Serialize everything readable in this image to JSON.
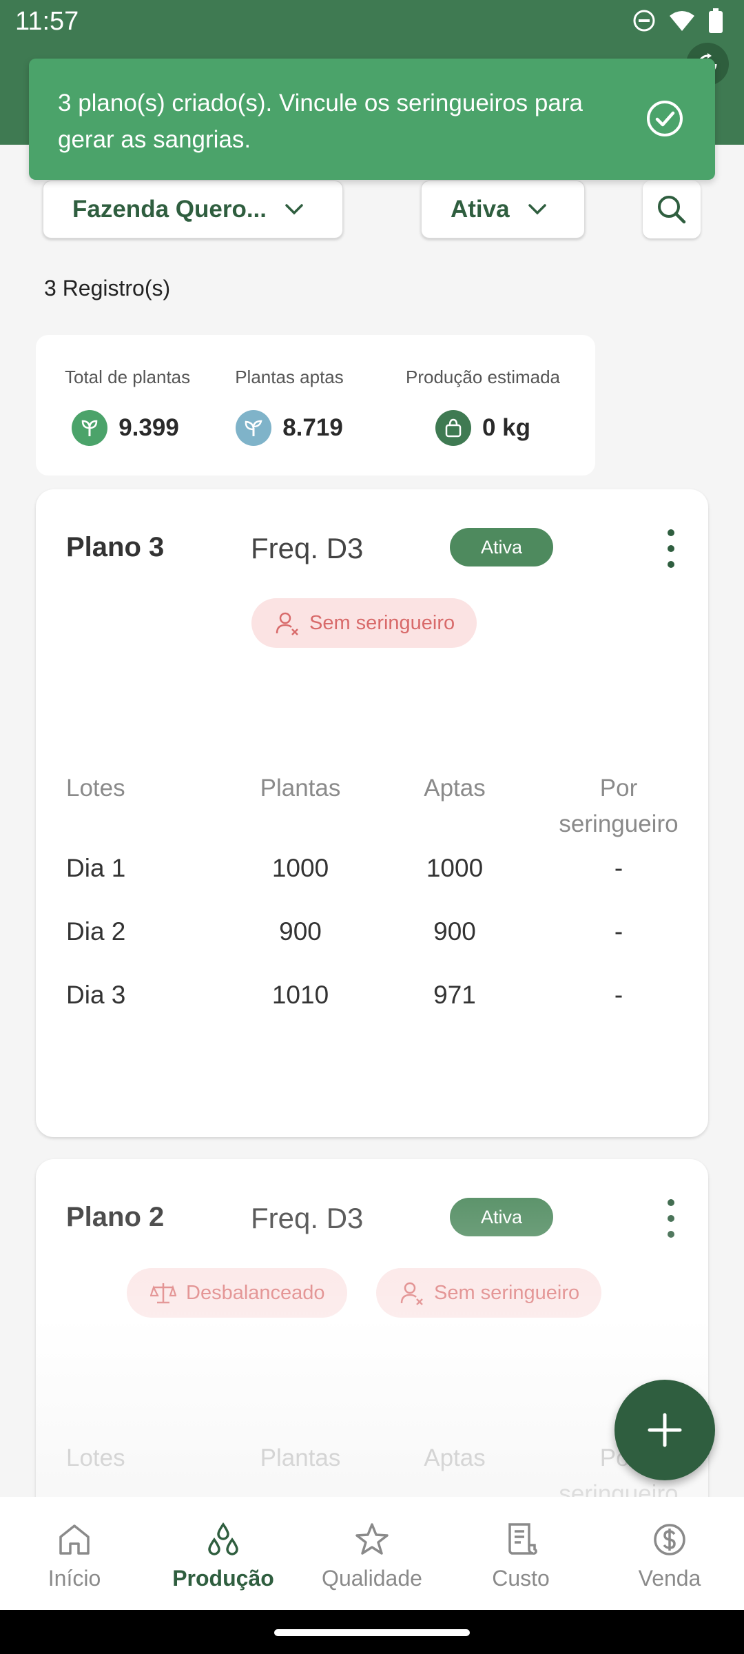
{
  "status_bar": {
    "time": "11:57"
  },
  "toast": {
    "message": "3 plano(s) criado(s). Vincule os seringueiros para gerar as sangrias.",
    "icon": "check-circle-icon"
  },
  "filters": {
    "farm": "Fazenda Quero...",
    "status": "Ativa"
  },
  "records": "3 Registro(s)",
  "summary": {
    "total_label": "Total de plantas",
    "total_value": "9.399",
    "aptas_label": "Plantas aptas",
    "aptas_value": "8.719",
    "producao_label": "Produção estimada",
    "producao_value": "0 kg"
  },
  "columns": {
    "lotes": "Lotes",
    "plantas": "Plantas",
    "aptas": "Aptas",
    "por_seringueiro": "Por seringueiro"
  },
  "plans": [
    {
      "title": "Plano 3",
      "freq": "Freq. D3",
      "status": "Ativa",
      "tags": [
        "Sem seringueiro"
      ],
      "rows": [
        {
          "lote": "Dia 1",
          "plantas": "1000",
          "aptas": "1000",
          "por_seringueiro": "-"
        },
        {
          "lote": "Dia 2",
          "plantas": "900",
          "aptas": "900",
          "por_seringueiro": "-"
        },
        {
          "lote": "Dia 3",
          "plantas": "1010",
          "aptas": "971",
          "por_seringueiro": "-"
        }
      ]
    },
    {
      "title": "Plano 2",
      "freq": "Freq. D3",
      "status": "Ativa",
      "tags": [
        "Desbalanceado",
        "Sem seringueiro"
      ],
      "rows": []
    }
  ],
  "nav": [
    {
      "label": "Início",
      "icon": "home-icon"
    },
    {
      "label": "Produção",
      "icon": "drops-icon"
    },
    {
      "label": "Qualidade",
      "icon": "star-icon"
    },
    {
      "label": "Custo",
      "icon": "receipt-icon"
    },
    {
      "label": "Venda",
      "icon": "dollar-icon"
    }
  ],
  "colors": {
    "primary": "#3f7a52",
    "primary_dark": "#2f5e3f",
    "toast": "#4ba36a",
    "tag_bg": "#fbe3e3",
    "tag_text": "#d86a6a"
  }
}
